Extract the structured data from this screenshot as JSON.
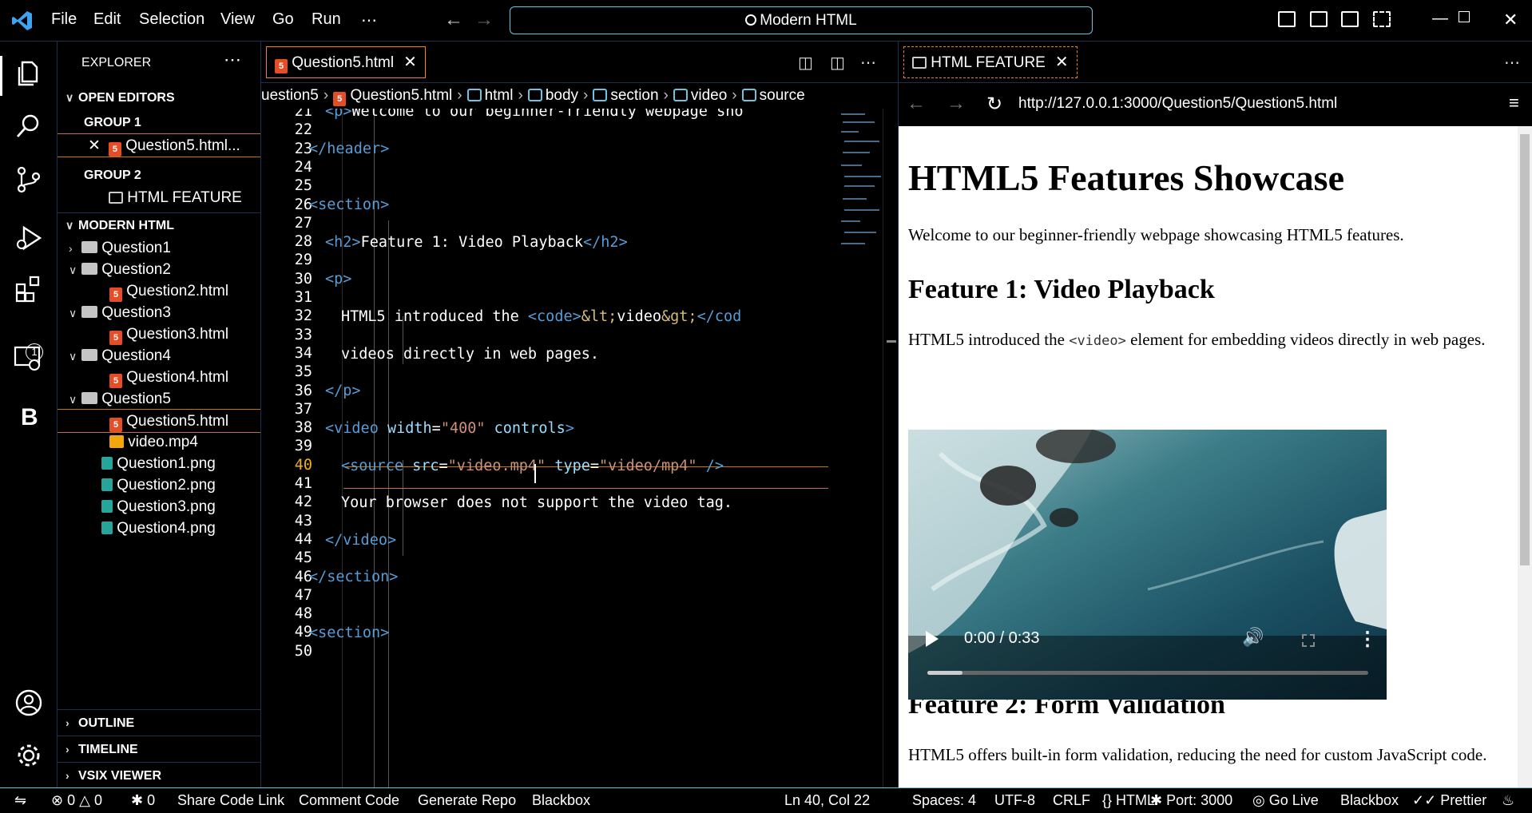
{
  "titlebar": {
    "menu": [
      "File",
      "Edit",
      "Selection",
      "View",
      "Go",
      "Run",
      "⋯"
    ],
    "search": "Modern HTML"
  },
  "activity": {
    "extensions_badge": "1",
    "custom_letter": "B"
  },
  "explorer": {
    "title": "EXPLORER",
    "open_editors": "OPEN EDITORS",
    "group1": "GROUP 1",
    "group1_file": "Question5.html...",
    "group2": "GROUP 2",
    "group2_item": "HTML FEATURE",
    "workspace": "MODERN HTML",
    "tree": [
      {
        "label": "Question1"
      },
      {
        "label": "Question2"
      },
      {
        "label": "Question2.html"
      },
      {
        "label": "Question3"
      },
      {
        "label": "Question3.html"
      },
      {
        "label": "Question4"
      },
      {
        "label": "Question4.html"
      },
      {
        "label": "Question5"
      },
      {
        "label": "Question5.html"
      },
      {
        "label": "video.mp4"
      },
      {
        "label": "Question1.png"
      },
      {
        "label": "Question2.png"
      },
      {
        "label": "Question3.png"
      },
      {
        "label": "Question4.png"
      }
    ],
    "outline": "OUTLINE",
    "timeline": "TIMELINE",
    "vsix": "VSIX VIEWER"
  },
  "editor": {
    "tab_label": "Question5.html",
    "breadcrumb": [
      "uestion5",
      "Question5.html",
      "html",
      "body",
      "section",
      "video",
      "source"
    ],
    "line_numbers": [
      "21",
      "22",
      "23",
      "24",
      "25",
      "26",
      "27",
      "28",
      "29",
      "30",
      "31",
      "32",
      "33",
      "34",
      "35",
      "36",
      "37",
      "38",
      "39",
      "40",
      "41",
      "42",
      "43",
      "44",
      "45",
      "46",
      "47",
      "48",
      "49",
      "50"
    ],
    "current_line": "40",
    "code": {
      "l21_a": "<p>",
      "l21_b": "Welcome to our beginner-friendly webpage sho",
      "l23": "</header>",
      "l26": "<section>",
      "l28_a": "<h2>",
      "l28_b": "Feature 1: Video Playback",
      "l28_c": "</h2>",
      "l30": "<p>",
      "l32_a": "HTML5 introduced the ",
      "l32_b": "<code>",
      "l32_c": "&lt;",
      "l32_d": "video",
      "l32_e": "&gt;",
      "l32_f": "</cod",
      "l34": "videos directly in web pages.",
      "l36": "</p>",
      "l38_a": "<video ",
      "l38_b": "width",
      "l38_c": "=",
      "l38_d": "\"400\"",
      "l38_e": " controls",
      "l38_f": ">",
      "l40_a": "<source ",
      "l40_b": "src",
      "l40_c": "=",
      "l40_d": "\"video.mp4\"",
      "l40_e": " type",
      "l40_f": "=",
      "l40_g": "\"video/mp4\"",
      "l40_h": " />",
      "l42": "Your browser does not support the video tag.",
      "l44": "</video>",
      "l46": "</section>",
      "l49": "<section>"
    }
  },
  "preview": {
    "tab_label": "HTML FEATURE",
    "url": "http://127.0.0.1:3000/Question5/Question5.html",
    "h1": "HTML5 Features Showcase",
    "intro": "Welcome to our beginner-friendly webpage showcasing HTML5 features.",
    "feature1_title": "Feature 1: Video Playback",
    "feature1_text_a": "HTML5 introduced the ",
    "feature1_code": "<video>",
    "feature1_text_b": " element for embedding videos directly in web pages.",
    "video_time": "0:00 / 0:33",
    "video_progress": 0.08,
    "feature2_title": "Feature 2: Form Validation",
    "feature2_text": "HTML5 offers built-in form validation, reducing the need for custom JavaScript code."
  },
  "statusbar": {
    "errors": "0",
    "warnings": "0",
    "ports": "0",
    "share": "Share Code Link",
    "comment": "Comment Code",
    "repo": "Generate Repo",
    "blackbox_left": "Blackbox",
    "position": "Ln 40, Col 22",
    "spaces": "Spaces: 4",
    "encoding": "UTF-8",
    "eol": "CRLF",
    "language": "HTML",
    "port": "Port: 3000",
    "golive": "Go Live",
    "blackbox_right": "Blackbox",
    "prettier": "Prettier"
  },
  "colors": {
    "accent_border": "#6fc3df",
    "active_tab_border": "#f38518",
    "html_icon": "#e44d26"
  }
}
